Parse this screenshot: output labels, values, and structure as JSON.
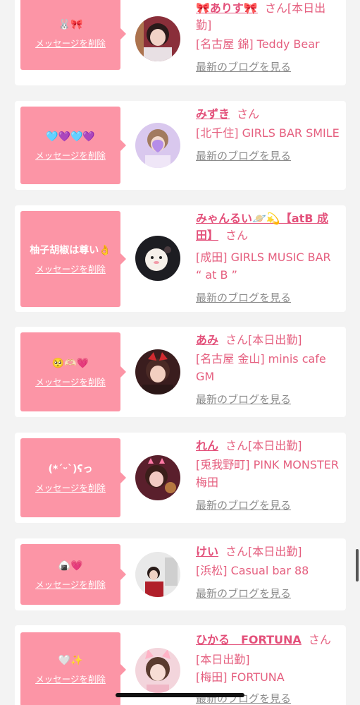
{
  "message_list": {
    "delete_label": "メッセージを削除",
    "blog_label": "最新のブログを見る",
    "honorific": "さん",
    "items": [
      {
        "message": "🐰🎀",
        "name": "🎀ありす🎀",
        "status": "[本日出勤]",
        "shop": "[名古屋 錦] Teddy Bear",
        "avatar": "photo-avatar"
      },
      {
        "message": "🩵💜🩵💜",
        "name": "みずき",
        "status": "",
        "shop": "[北千住] GIRLS BAR SMILE",
        "avatar": "photo-avatar"
      },
      {
        "message": "柚子胡椒は尊い👌",
        "name": "みゃんるい🪐💫【atB 成田】",
        "status": "",
        "shop": "[成田] GIRLS MUSIC BAR “ at B ”",
        "avatar": "photo-avatar"
      },
      {
        "message": "🥺🫶🏻💗",
        "name": "あみ",
        "status": "[本日出勤]",
        "shop": "[名古屋 金山] minis cafe GM",
        "avatar": "photo-avatar"
      },
      {
        "message": "(*ˊᵕˋ)ʕっ",
        "name": "れん",
        "status": "[本日出勤]",
        "shop": "[兎我野町] PINK MONSTER梅田",
        "avatar": "photo-avatar"
      },
      {
        "message": "🍙💗",
        "name": "けい",
        "status": "[本日出勤]",
        "shop": "[浜松] Casual bar 88",
        "avatar": "photo-avatar"
      },
      {
        "message": "🤍✨",
        "name": "ひかる　FORTUNA",
        "status": "[本日出勤]",
        "shop": "[梅田] FORTUNA",
        "avatar": "photo-avatar"
      }
    ]
  },
  "colors": {
    "accent": "#fc95a6",
    "name": "#e3507a",
    "text": "#e55f7f",
    "link": "#8c8c8c",
    "background": "#f3f3f3"
  }
}
